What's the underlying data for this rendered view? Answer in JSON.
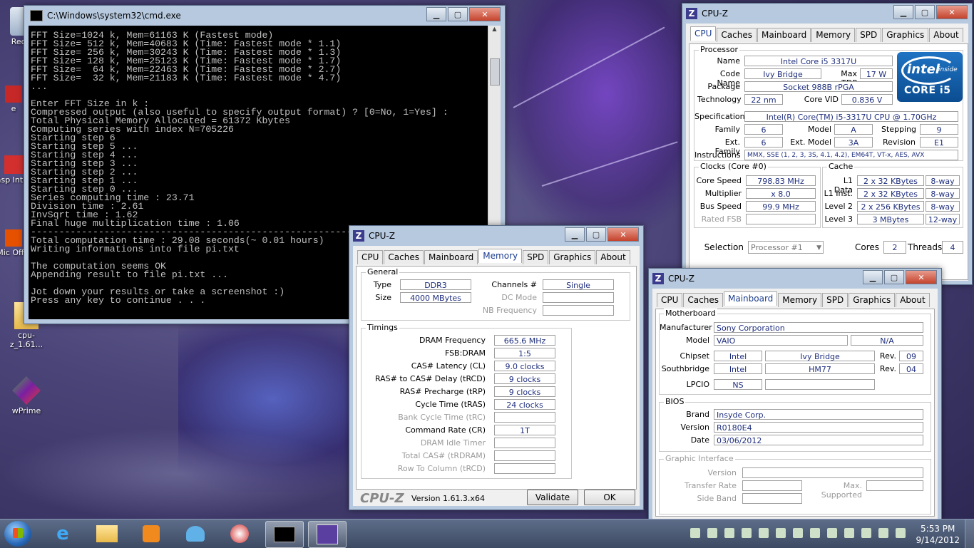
{
  "desktop": {
    "icons": [
      {
        "label": "Recy"
      },
      {
        "label": "e"
      },
      {
        "label": "Kasp Intern"
      },
      {
        "label": "Mic Offic"
      },
      {
        "label": "cpu-z_1.61..."
      },
      {
        "label": "wPrime"
      }
    ]
  },
  "cmd": {
    "title": "C:\\Windows\\system32\\cmd.exe",
    "lines": [
      "FFT Size=1024 k, Mem=61163 K (Fastest mode)",
      "FFT Size= 512 k, Mem=40683 K (Time: Fastest mode * 1.1)",
      "FFT Size= 256 k, Mem=30243 K (Time: Fastest mode * 1.3)",
      "FFT Size= 128 k, Mem=25123 K (Time: Fastest mode * 1.7)",
      "FFT Size=  64 k, Mem=22463 K (Time: Fastest mode * 2.7)",
      "FFT Size=  32 k, Mem=21183 K (Time: Fastest mode * 4.7)",
      "...",
      "",
      "Enter FFT Size in k :",
      "Compressed output (also useful to specify output format) ? [0=No, 1=Yes] :",
      "Total Physical Memory Allocated = 61372 Kbytes",
      "Computing series with index N=705226",
      "Starting step 6",
      "Starting step 5 ...",
      "Starting step 4 ...",
      "Starting step 3 ...",
      "Starting step 2 ...",
      "Starting step 1 ...",
      "Starting step 0 ...",
      "Series computing time : 23.71",
      "Division time : 2.61",
      "InvSqrt time : 1.62",
      "Final huge multiplication time : 1.06",
      "--------------------------------------------------------------------------------",
      "Total computation time : 29.08 seconds(~ 0.01 hours)",
      "Writing informations into file pi.txt",
      "",
      "The computation seems OK",
      "Appending result to file pi.txt ...",
      "",
      "Jot down your results or take a screenshot :)",
      "Press any key to continue . . ."
    ]
  },
  "cpuz_tabs": [
    "CPU",
    "Caches",
    "Mainboard",
    "Memory",
    "SPD",
    "Graphics",
    "About"
  ],
  "cpuz_main": {
    "title": "CPU-Z",
    "processor_group": "Processor",
    "name_label": "Name",
    "name": "Intel Core i5 3317U",
    "codename_label": "Code Name",
    "codename": "Ivy Bridge",
    "maxtdp_label": "Max TDP",
    "maxtdp": "17 W",
    "package_label": "Package",
    "package": "Socket 988B rPGA",
    "technology_label": "Technology",
    "technology": "22 nm",
    "corevid_label": "Core VID",
    "corevid": "0.836 V",
    "spec_label": "Specification",
    "spec": "Intel(R) Core(TM) i5-3317U CPU @ 1.70GHz",
    "family_label": "Family",
    "family": "6",
    "model_label": "Model",
    "model": "A",
    "stepping_label": "Stepping",
    "stepping": "9",
    "extfamily_label": "Ext. Family",
    "extfamily": "6",
    "extmodel_label": "Ext. Model",
    "extmodel": "3A",
    "revision_label": "Revision",
    "revision": "E1",
    "instructions_label": "Instructions",
    "instructions": "MMX, SSE (1, 2, 3, 3S, 4.1, 4.2), EM64T, VT-x, AES, AVX",
    "clocks_group": "Clocks (Core #0)",
    "corespeed_label": "Core Speed",
    "corespeed": "798.83 MHz",
    "multiplier_label": "Multiplier",
    "multiplier": "x 8.0",
    "busspeed_label": "Bus Speed",
    "busspeed": "99.9 MHz",
    "ratedfsb_label": "Rated FSB",
    "cache_group": "Cache",
    "l1data_label": "L1 Data",
    "l1data": "2 x 32 KBytes",
    "l1data_way": "8-way",
    "l1inst_label": "L1 Inst.",
    "l1inst": "2 x 32 KBytes",
    "l1inst_way": "8-way",
    "level2_label": "Level 2",
    "level2": "2 x 256 KBytes",
    "level2_way": "8-way",
    "level3_label": "Level 3",
    "level3": "3 MBytes",
    "level3_way": "12-way",
    "selection_label": "Selection",
    "selection": "Processor #1",
    "cores_label": "Cores",
    "cores": "2",
    "threads_label": "Threads",
    "threads": "4",
    "intel_inside": "intel",
    "intel_inside_sub": "inside",
    "intel_core": "CORE i5"
  },
  "cpuz_mem": {
    "title": "CPU-Z",
    "general_group": "General",
    "type_label": "Type",
    "type": "DDR3",
    "size_label": "Size",
    "size": "4000 MBytes",
    "channels_label": "Channels #",
    "channels": "Single",
    "dcmode_label": "DC Mode",
    "nbfreq_label": "NB Frequency",
    "timings_group": "Timings",
    "timings": [
      {
        "label": "DRAM Frequency",
        "value": "665.6 MHz",
        "dim": false
      },
      {
        "label": "FSB:DRAM",
        "value": "1:5",
        "dim": false
      },
      {
        "label": "CAS# Latency (CL)",
        "value": "9.0 clocks",
        "dim": false
      },
      {
        "label": "RAS# to CAS# Delay (tRCD)",
        "value": "9 clocks",
        "dim": false
      },
      {
        "label": "RAS# Precharge (tRP)",
        "value": "9 clocks",
        "dim": false
      },
      {
        "label": "Cycle Time (tRAS)",
        "value": "24 clocks",
        "dim": false
      },
      {
        "label": "Bank Cycle Time (tRC)",
        "value": "",
        "dim": true
      },
      {
        "label": "Command Rate (CR)",
        "value": "1T",
        "dim": false
      },
      {
        "label": "DRAM Idle Timer",
        "value": "",
        "dim": true
      },
      {
        "label": "Total CAS# (tRDRAM)",
        "value": "",
        "dim": true
      },
      {
        "label": "Row To Column (tRCD)",
        "value": "",
        "dim": true
      }
    ],
    "brand": "CPU-Z",
    "version": "Version 1.61.3.x64",
    "validate": "Validate",
    "ok": "OK"
  },
  "cpuz_mb": {
    "title": "CPU-Z",
    "motherboard_group": "Motherboard",
    "manufacturer_label": "Manufacturer",
    "manufacturer": "Sony Corporation",
    "model_label": "Model",
    "model": "VAIO",
    "model_rev": "N/A",
    "chipset_label": "Chipset",
    "chipset_vendor": "Intel",
    "chipset": "Ivy Bridge",
    "chipset_rev_label": "Rev.",
    "chipset_rev": "09",
    "southbridge_label": "Southbridge",
    "southbridge_vendor": "Intel",
    "southbridge": "HM77",
    "southbridge_rev_label": "Rev.",
    "southbridge_rev": "04",
    "lpcio_label": "LPCIO",
    "lpcio": "NS",
    "bios_group": "BIOS",
    "brand_label": "Brand",
    "brand": "Insyde Corp.",
    "version_label": "Version",
    "version": "R0180E4",
    "date_label": "Date",
    "date": "03/06/2012",
    "gi_group": "Graphic Interface",
    "gi_version_label": "Version",
    "gi_transfer_label": "Transfer Rate",
    "gi_maxsupported_label": "Max. Supported",
    "gi_sideband_label": "Side Band"
  },
  "taskbar": {
    "time": "5:53 PM",
    "date": "9/14/2012"
  }
}
